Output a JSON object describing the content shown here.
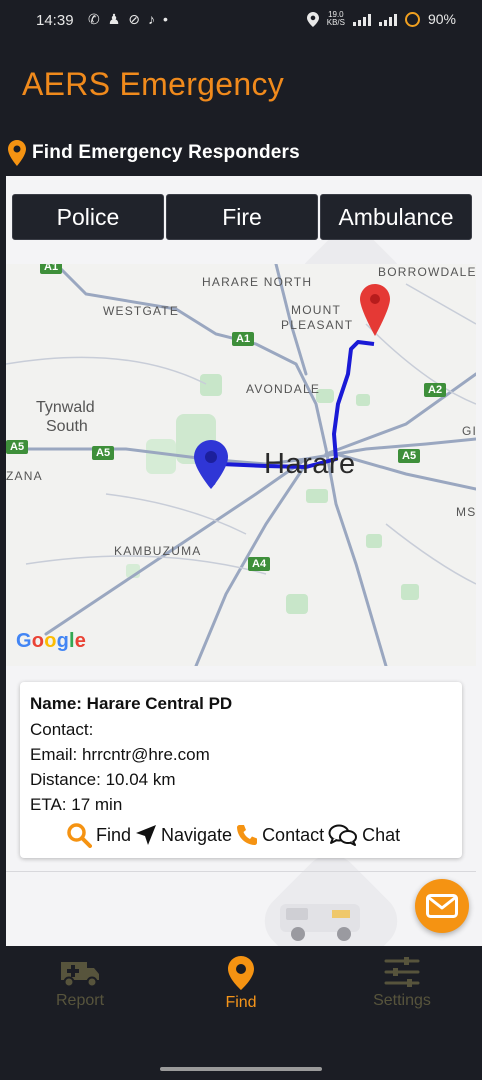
{
  "status_bar": {
    "time": "14:39",
    "net_speed_value": "19.0",
    "net_speed_unit": "KB/S",
    "battery": "90%"
  },
  "app": {
    "title": "AERS Emergency"
  },
  "section": {
    "title": "Find Emergency Responders"
  },
  "tabs": [
    {
      "label": "Police"
    },
    {
      "label": "Fire"
    },
    {
      "label": "Ambulance"
    }
  ],
  "map": {
    "city": "Harare",
    "labels": {
      "harare_north": "HARARE NORTH",
      "borrowdale": "BORROWDALE",
      "westgate": "WESTGATE",
      "mount_pleasant_1": "MOUNT",
      "mount_pleasant_2": "PLEASANT",
      "avondale": "AVONDALE",
      "tynwald_1": "Tynwald",
      "tynwald_2": "South",
      "kambuzuma": "KAMBUZUMA",
      "zana": "ZANA",
      "ms": "MS",
      "gl": "GI"
    },
    "road_shields": [
      "A1",
      "A1",
      "A2",
      "A5",
      "A5",
      "A5",
      "A4"
    ],
    "google_logo": [
      "G",
      "o",
      "o",
      "g",
      "l",
      "e"
    ]
  },
  "responder": {
    "name": "Name: Harare Central PD",
    "contact": "Contact:",
    "email": "Email: hrrcntr@hre.com",
    "distance": "Distance: 10.04 km",
    "eta": "ETA: 17 min"
  },
  "actions": {
    "find": "Find",
    "navigate": "Navigate",
    "contact": "Contact",
    "chat": "Chat"
  },
  "bottom_nav": [
    {
      "label": "Report",
      "icon": "ambulance-icon",
      "active": false
    },
    {
      "label": "Find",
      "icon": "location-pin-icon",
      "active": true
    },
    {
      "label": "Settings",
      "icon": "sliders-icon",
      "active": false
    }
  ],
  "colors": {
    "accent": "#f08a1c",
    "background": "#1b1d24",
    "route": "#1a1ad6",
    "marker_destination": "#d32f2f",
    "marker_origin": "#2f36d6",
    "road_shield": "#3e8f3a"
  }
}
